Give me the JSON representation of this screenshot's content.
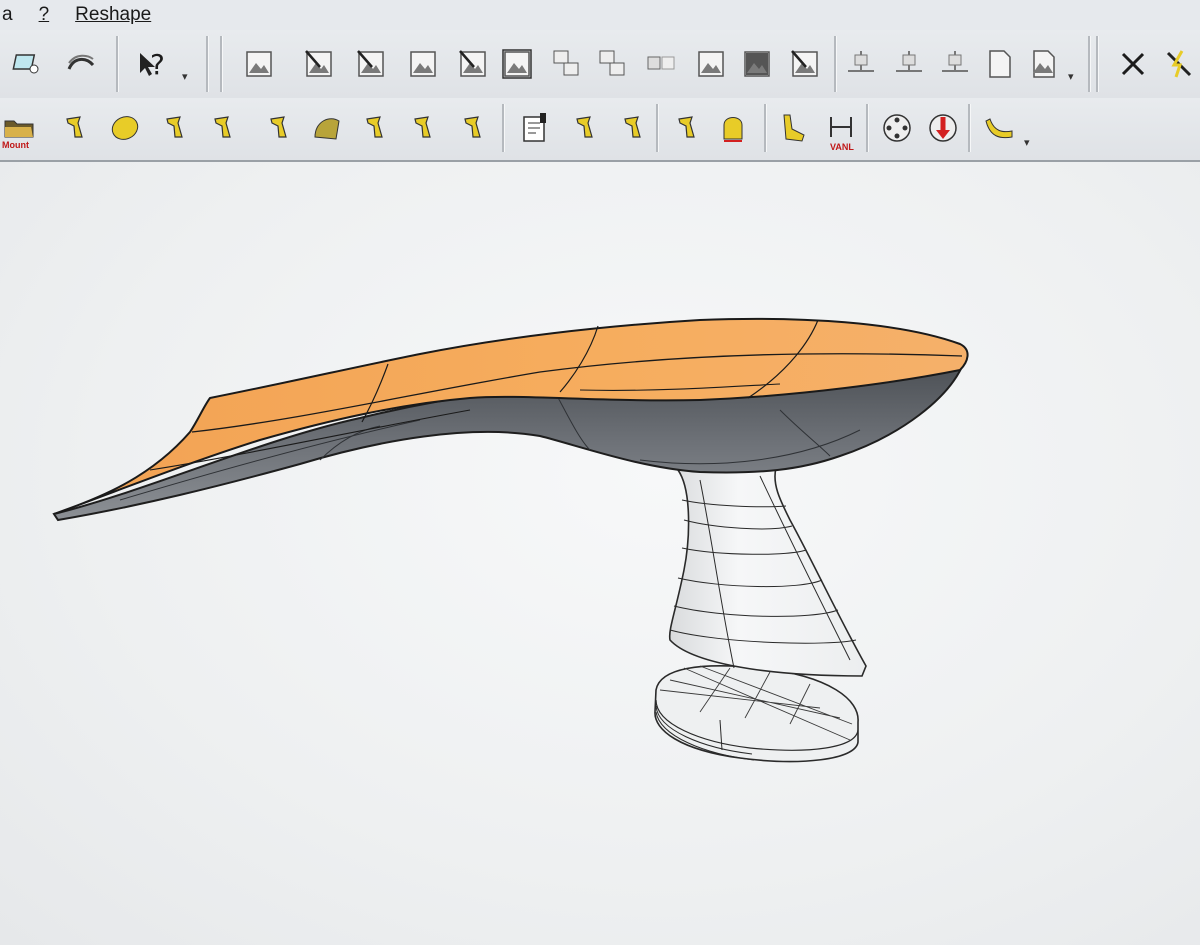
{
  "menu": {
    "items": [
      {
        "name": "menu-a",
        "label": "a"
      },
      {
        "name": "menu-help",
        "label": "?"
      },
      {
        "name": "menu-reshape",
        "label": "Reshape"
      }
    ]
  },
  "toolbar1": {
    "help_glyph": "?",
    "close_glyph": "✕"
  },
  "toolbar2": {
    "mount_label": "Mount",
    "vanl_label": "VANL"
  },
  "colors": {
    "insole_top": "#f4a95a",
    "insole_shade": "#e89a4a",
    "shell": "#5d6166",
    "pedestal": "#f1f2f3",
    "icon_yellow": "#e8cc28",
    "accent_red": "#d32020"
  },
  "icons": {
    "toolbar1": [
      "view-orbit-icon",
      "surface-icon",
      "help-pointer-icon",
      "image-icon",
      "mesh-edit-icon",
      "mesh-select-icon",
      "grid-image-icon",
      "transform-image-icon",
      "frame-image-icon",
      "copy-image-icon",
      "stack-icon",
      "small-grid-icon",
      "crop-icon",
      "dark-image-icon",
      "paint-icon",
      "align-point-icon",
      "align-point-2-icon",
      "align-edit-icon",
      "page-icon",
      "page-image-icon",
      "close-icon",
      "lightning-edit-icon"
    ],
    "toolbar2": [
      "folder-mount-icon",
      "paste-last-icon",
      "insole-yellow-icon",
      "last-rotate-icon",
      "last-cut-icon",
      "last-points-icon",
      "surface-wrap-icon",
      "last-split-icon",
      "foot-align-icon",
      "last-arrow-icon",
      "document-edit-icon",
      "last-height-icon",
      "last-box-icon",
      "last-grid-icon",
      "heel-cup-icon",
      "foot-side-icon",
      "vanl-measure-icon",
      "rotate-circle-icon",
      "red-down-circle-icon",
      "insole-profile-icon"
    ]
  }
}
